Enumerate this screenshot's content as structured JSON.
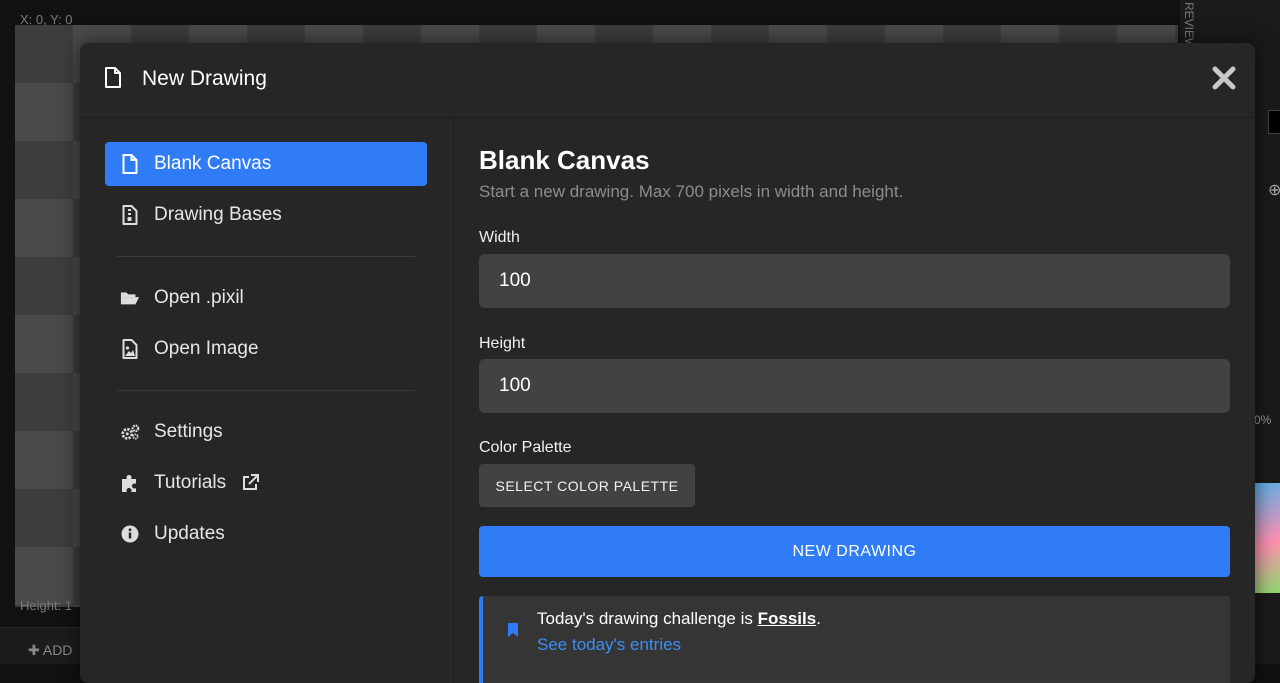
{
  "background": {
    "coord_text": "X: 0, Y: 0",
    "dims_text": "Height: 1",
    "add_label": "ADD",
    "preview_label": "REVIEW",
    "zoom_text": "0%"
  },
  "modal": {
    "title": "New Drawing",
    "title_icon": "file-icon",
    "close_icon": "close-icon"
  },
  "sidebar": {
    "items": [
      {
        "label": "Blank Canvas",
        "icon": "file-icon",
        "active": true
      },
      {
        "label": "Drawing Bases",
        "icon": "file-zipper-icon"
      },
      {
        "label": "Open .pixil",
        "icon": "folder-open-icon"
      },
      {
        "label": "Open Image",
        "icon": "image-icon"
      },
      {
        "label": "Settings",
        "icon": "gears-icon"
      },
      {
        "label": "Tutorials",
        "icon": "puzzle-piece-icon",
        "suffix_icon": "external-link-icon"
      },
      {
        "label": "Updates",
        "icon": "info-circle-icon"
      }
    ]
  },
  "content": {
    "title": "Blank Canvas",
    "description": "Start a new drawing. Max 700 pixels in width and height.",
    "width_label": "Width",
    "width_value": "100",
    "height_label": "Height",
    "height_value": "100",
    "palette_label": "Color Palette",
    "palette_button": "SELECT COLOR PALETTE",
    "submit_button": "NEW DRAWING",
    "challenge": {
      "prefix": "Today's drawing challenge is ",
      "topic": "Fossils",
      "suffix": ".",
      "link": "See today's entries",
      "icon": "bookmark-icon"
    }
  },
  "colors": {
    "accent": "#2f7cf6",
    "modal_bg": "#262626",
    "input_bg": "#424242",
    "link": "#3d8ef8"
  }
}
